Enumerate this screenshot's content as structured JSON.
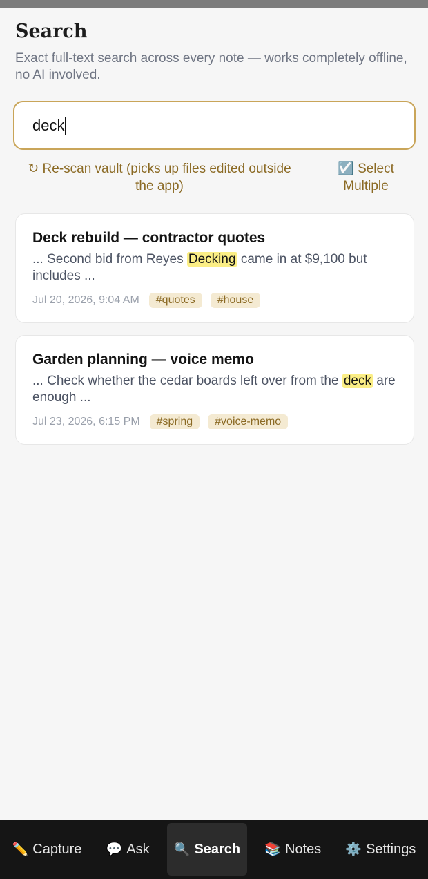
{
  "page": {
    "title": "Search",
    "subtitle": "Exact full-text search across every note — works completely offline, no AI involved."
  },
  "search": {
    "value": "deck"
  },
  "actions": {
    "rescan_icon": "↻",
    "rescan_label": "Re-scan vault (picks up files edited outside the app)",
    "select_icon": "☑️",
    "select_label": "Select Multiple"
  },
  "results": [
    {
      "title": "Deck rebuild — contractor quotes",
      "snippet_before": "... Second bid from Reyes ",
      "snippet_match": "Decking",
      "snippet_after": " came in at $9,100 but includes ...",
      "date": "Jul 20, 2026, 9:04 AM",
      "tags": [
        "#quotes",
        "#house"
      ]
    },
    {
      "title": "Garden planning — voice memo",
      "snippet_before": "... Check whether the cedar boards left over from the ",
      "snippet_match": "deck",
      "snippet_after": " are enough ...",
      "date": "Jul 23, 2026, 6:15 PM",
      "tags": [
        "#spring",
        "#voice-memo"
      ]
    }
  ],
  "nav": [
    {
      "icon": "✏️",
      "label": "Capture",
      "icon_name": "pencil-icon"
    },
    {
      "icon": "💬",
      "label": "Ask",
      "icon_name": "speech-bubble-icon"
    },
    {
      "icon": "🔍",
      "label": "Search",
      "icon_name": "magnifier-icon",
      "active": true
    },
    {
      "icon": "📚",
      "label": "Notes",
      "icon_name": "books-icon"
    },
    {
      "icon": "⚙️",
      "label": "Settings",
      "icon_name": "gear-icon"
    }
  ],
  "colors": {
    "accent": "#c9a559",
    "accent_text": "#8b6a24",
    "highlight": "#fbee85",
    "tag_bg": "#f4ead2",
    "nav_bg": "#151515"
  }
}
